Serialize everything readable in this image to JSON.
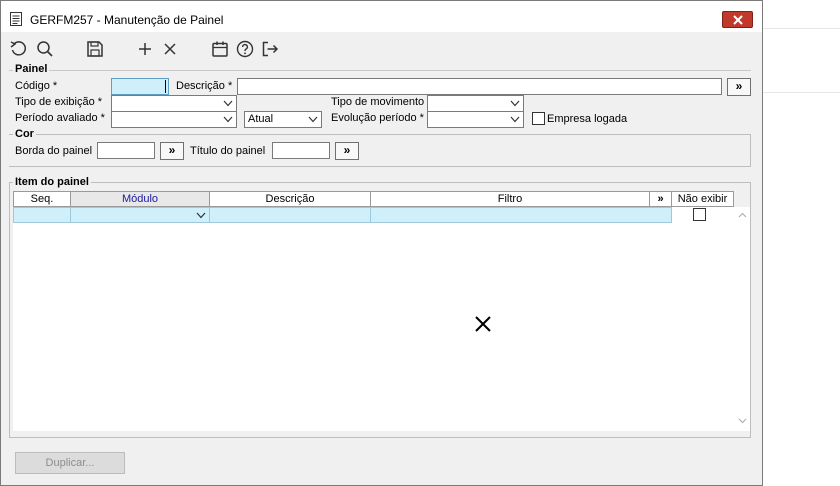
{
  "window": {
    "title": "GERFM257 - Manutenção de Painel",
    "close_icon": "close-icon"
  },
  "toolbar": {
    "items": [
      {
        "icon": "undo-icon"
      },
      {
        "icon": "search-icon"
      },
      {
        "icon": "save-icon"
      },
      {
        "icon": "add-icon"
      },
      {
        "icon": "delete-icon"
      },
      {
        "icon": "calendar-icon"
      },
      {
        "icon": "help-icon"
      },
      {
        "icon": "exit-icon"
      }
    ]
  },
  "painel": {
    "group_title": "Painel",
    "codigo_label": "Código *",
    "codigo_value": "",
    "descricao_label": "Descrição *",
    "descricao_value": "",
    "lookup_label": "»",
    "tipo_exibicao_label": "Tipo de exibição *",
    "tipo_exibicao_value": "",
    "tipo_movimento_label": "Tipo de movimento",
    "tipo_movimento_value": "",
    "periodo_label": "Período avaliado *",
    "periodo_value": "",
    "periodo_ref_value": "Atual",
    "evolucao_label": "Evolução período *",
    "evolucao_value": "",
    "empresa_logada_label": "Empresa logada",
    "empresa_logada_checked": false
  },
  "cor": {
    "group_title": "Cor",
    "borda_label": "Borda do painel",
    "borda_value": "",
    "titulo_label": "Título do painel",
    "titulo_value": "",
    "lookup_label": "»"
  },
  "itens": {
    "group_title": "Item do painel",
    "columns": [
      "Seq.",
      "Módulo",
      "Descrição",
      "Filtro",
      "»",
      "Não exibir"
    ],
    "rows": [
      {
        "seq": "",
        "modulo": "",
        "descricao": "",
        "filtro": "",
        "nao_exibir": false
      }
    ]
  },
  "footer": {
    "duplicar_label": "Duplicar..."
  }
}
